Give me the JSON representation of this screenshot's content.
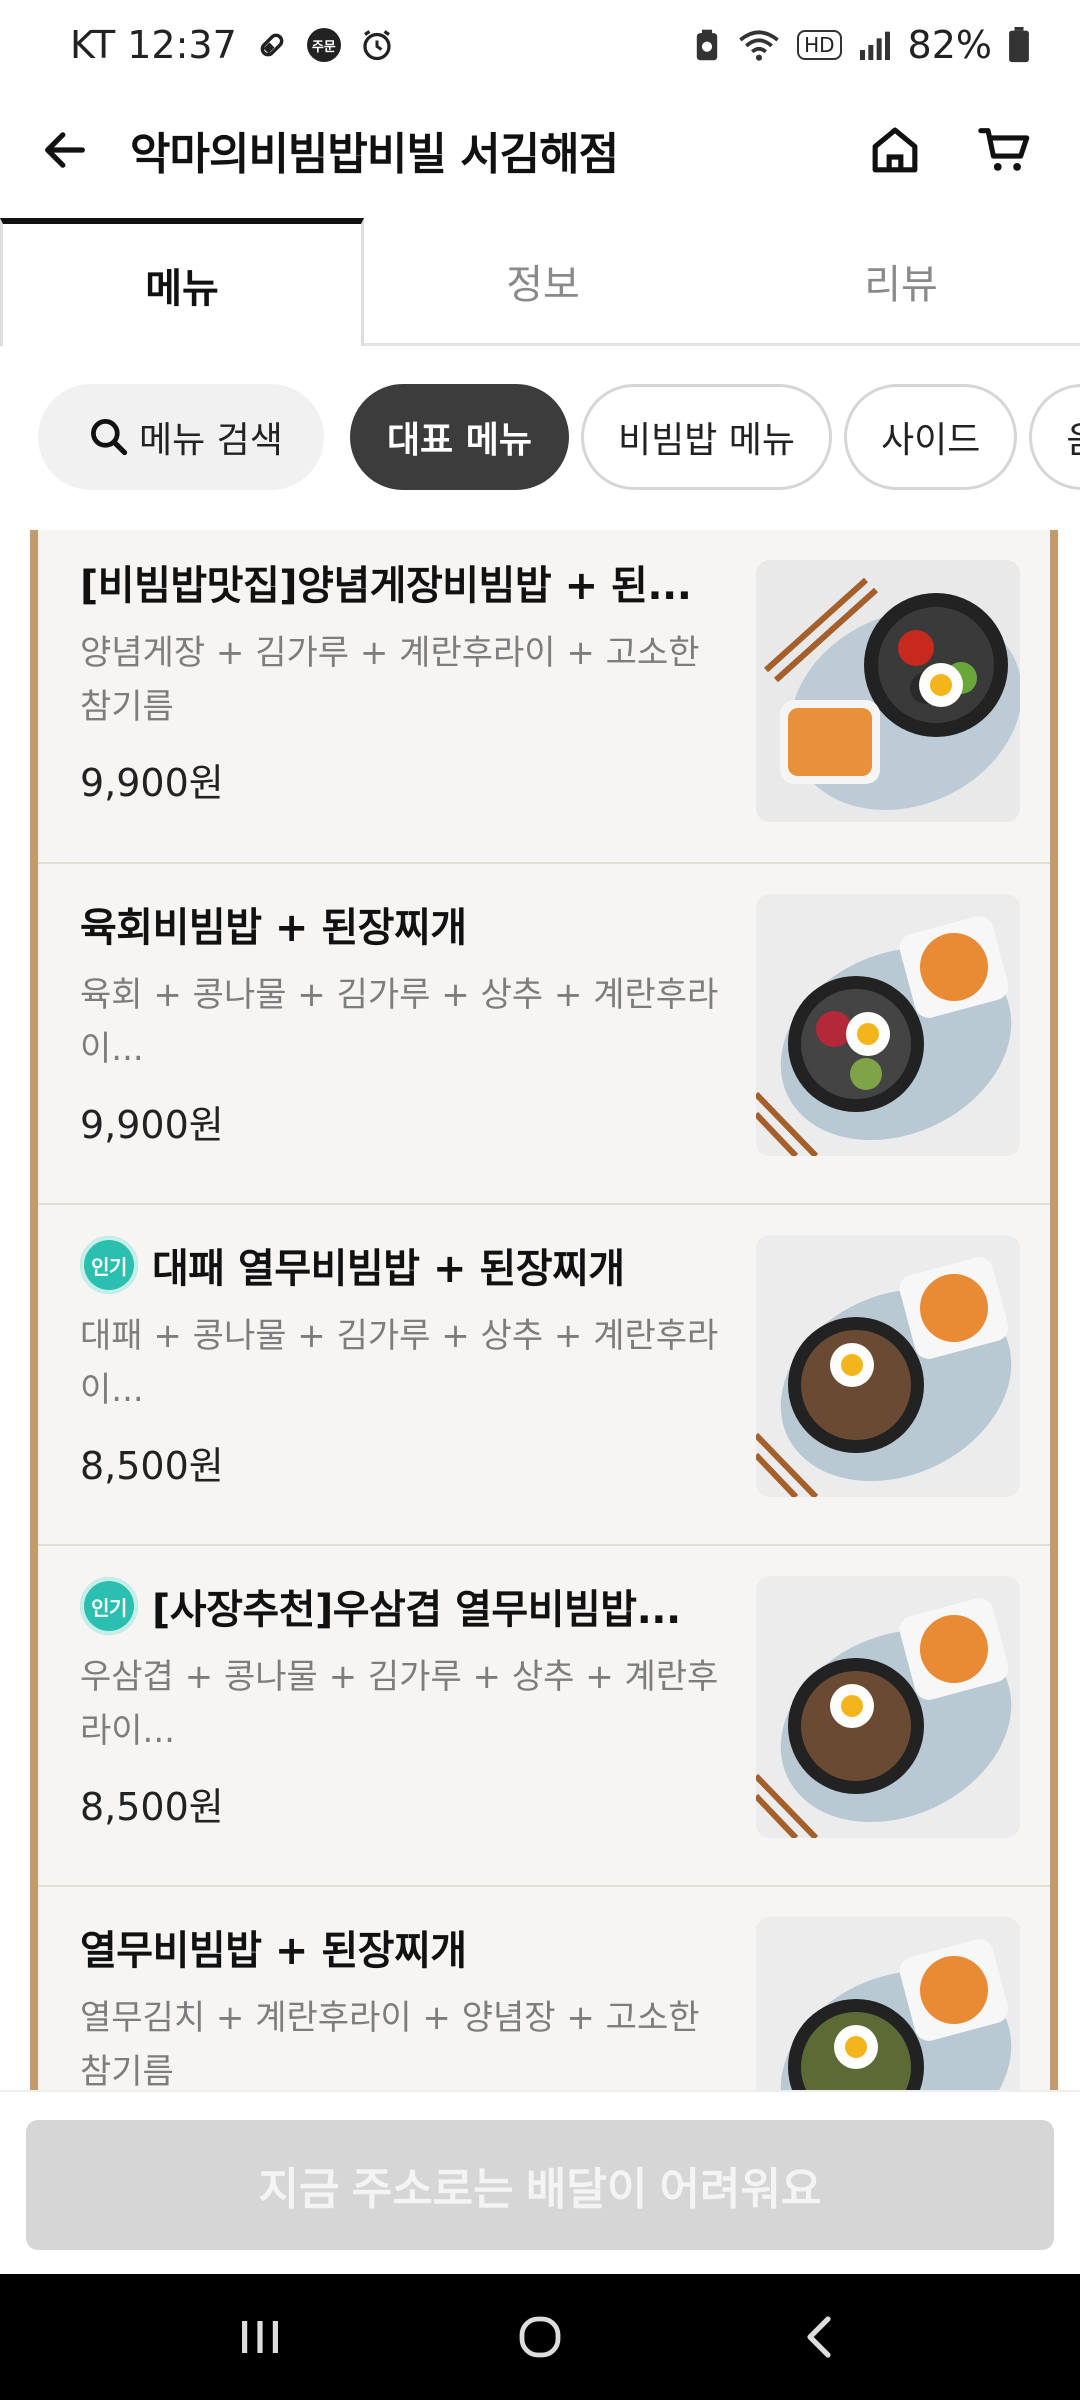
{
  "status_bar": {
    "carrier_time": "KT 12:37",
    "order_badge": "주문",
    "battery": "82%",
    "hd": "HD"
  },
  "header": {
    "title": "악마의비빔밥비빌 서김해점"
  },
  "tabs": [
    {
      "label": "메뉴"
    },
    {
      "label": "정보"
    },
    {
      "label": "리뷰"
    }
  ],
  "chips": {
    "search_label": "메뉴 검색",
    "items": [
      {
        "label": "대표 메뉴"
      },
      {
        "label": "비빔밥 메뉴"
      },
      {
        "label": "사이드"
      },
      {
        "label": "음료"
      }
    ]
  },
  "popular_badge": "인기",
  "menu_items": [
    {
      "name": "[비빔밥맛집]양념게장비빔밥 + 된...",
      "desc": "양념게장 + 김가루  + 계란후라이 + 고소한 참기름",
      "price": "9,900원",
      "popular": false,
      "image": "yangnyeom-gejang-bibimbap-photo"
    },
    {
      "name": "육회비빔밥 + 된장찌개",
      "desc": "육회 + 콩나물 + 김가루 + 상추 + 계란후라이...",
      "price": "9,900원",
      "popular": false,
      "image": "yukhoe-bibimbap-photo"
    },
    {
      "name": "대패 열무비빔밥 + 된장찌개",
      "desc": "대패 + 콩나물 + 김가루 + 상추 + 계란후라이...",
      "price": "8,500원",
      "popular": true,
      "image": "daepae-yeolmu-bibimbap-photo"
    },
    {
      "name": "[사장추천]우삼겹 열무비빔밥...",
      "desc": "우삼겹 + 콩나물 + 김가루 + 상추 + 계란후라이...",
      "price": "8,500원",
      "popular": true,
      "image": "usamgyeop-yeolmu-bibimbap-photo"
    },
    {
      "name": "열무비빔밥 + 된장찌개",
      "desc": "열무김치 + 계란후라이 + 양념장 + 고소한 참기름",
      "price": "",
      "popular": false,
      "image": "yeolmu-bibimbap-photo"
    }
  ],
  "cta": {
    "label": "지금 주소로는 배달이 어려워요"
  },
  "colors": {
    "frame_accent": "#c39a6b",
    "popular_badge": "#2bbfb0",
    "active_chip": "#3c3c3c",
    "cta_disabled": "#d6d6d6"
  }
}
